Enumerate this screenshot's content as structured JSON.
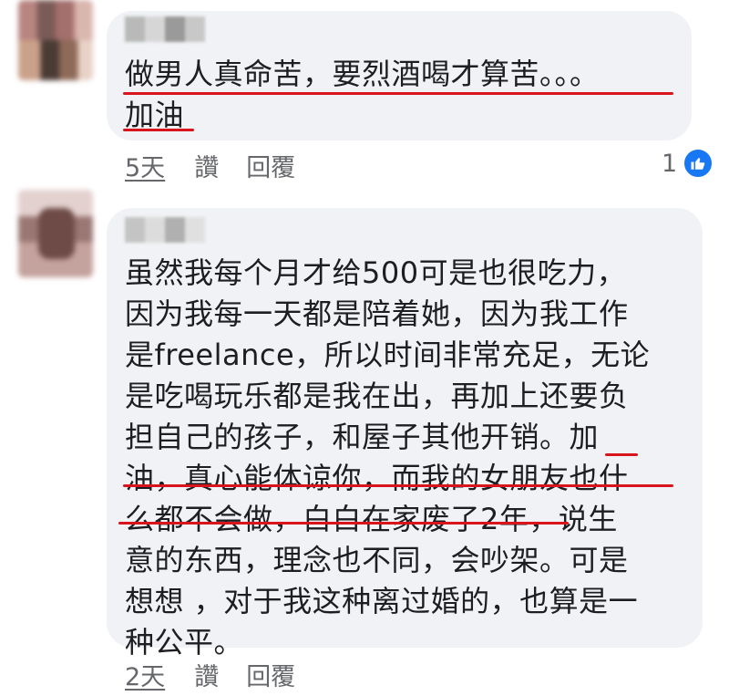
{
  "comments": [
    {
      "text": "做男人真命苦，要烈酒喝才算苦。。。\n加油",
      "time": "5天",
      "like_label": "讚",
      "reply_label": "回覆",
      "reaction_count": "1",
      "reaction_icon": "thumbs-up-icon"
    },
    {
      "text": "虽然我每个月才给500可是也很吃力，\n因为我每一天都是陪着她，因为我工作\n是freelance，所以时间非常充足，无论\n是吃喝玩乐都是我在出，再加上还要负\n担自己的孩子，和屋子其他开销。加\n油，真心能体谅你，而我的女朋友也什\n么都不会做，白白在家废了2年，说生\n意的东西，理念也不同，会吵架。可是\n想想 ，对于我这种离过婚的，也算是一\n种公平。",
      "time": "2天",
      "like_label": "讚",
      "reply_label": "回覆"
    }
  ],
  "colors": {
    "bubble": "#f0f2f5",
    "highlight_underline": "#d8141c",
    "meta_text": "#65676b",
    "like_blue": "#1877f2"
  }
}
